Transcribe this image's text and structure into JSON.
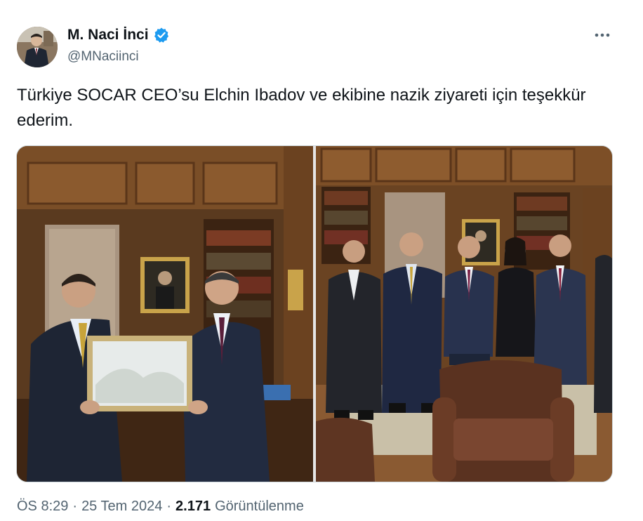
{
  "author": {
    "display_name": "M. Naci İnci",
    "handle": "@MNaciinci",
    "verified": true,
    "verified_color": "#1d9bf0"
  },
  "tweet": {
    "text": "Türkiye SOCAR CEO’su Elchin Ibadov ve ekibine nazik ziyareti için teşekkür ederim.",
    "time": "ÖS 8:29",
    "separator": "·",
    "date": "25 Tem 2024",
    "view_count": "2.171",
    "views_label": "Görüntülenme"
  },
  "icons": {
    "more": "more-horizontal-icon",
    "verified": "verified-badge-icon"
  },
  "media": {
    "photos": [
      {
        "name": "photo-presentation",
        "description_icon": "photo"
      },
      {
        "name": "photo-group",
        "description_icon": "photo"
      }
    ]
  }
}
